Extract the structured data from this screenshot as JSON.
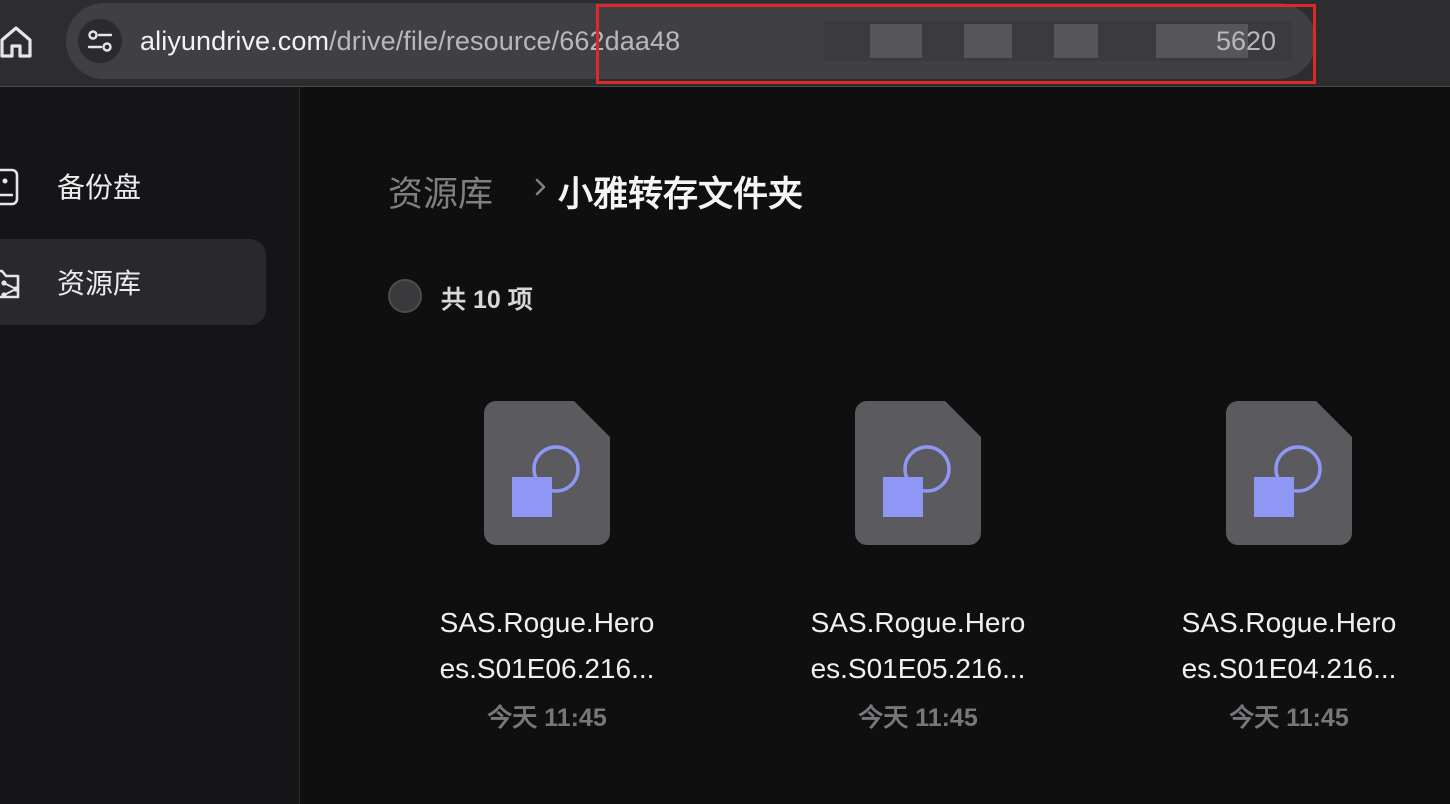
{
  "browser": {
    "url_host": "aliyundrive.com",
    "url_path": "/drive/file/resource/662daa48",
    "url_tail": "5620"
  },
  "sidebar": {
    "items": [
      {
        "label": "备份盘",
        "icon": "backup-drive-icon"
      },
      {
        "label": "资源库",
        "icon": "resource-library-icon",
        "active": true
      }
    ]
  },
  "breadcrumb": {
    "root": "资源库",
    "current": "小雅转存文件夹"
  },
  "summary": {
    "count_text": "共 10 项"
  },
  "files": [
    {
      "name_line1": "SAS.Rogue.Hero",
      "name_line2": "es.S01E06.216...",
      "time": "今天 11:45"
    },
    {
      "name_line1": "SAS.Rogue.Hero",
      "name_line2": "es.S01E05.216...",
      "time": "今天 11:45"
    },
    {
      "name_line1": "SAS.Rogue.Hero",
      "name_line2": "es.S01E04.216...",
      "time": "今天 11:45"
    }
  ],
  "colors": {
    "highlight_border": "#e0282a",
    "file_icon_accent": "#8e97f3",
    "background": "#0f0f10"
  }
}
